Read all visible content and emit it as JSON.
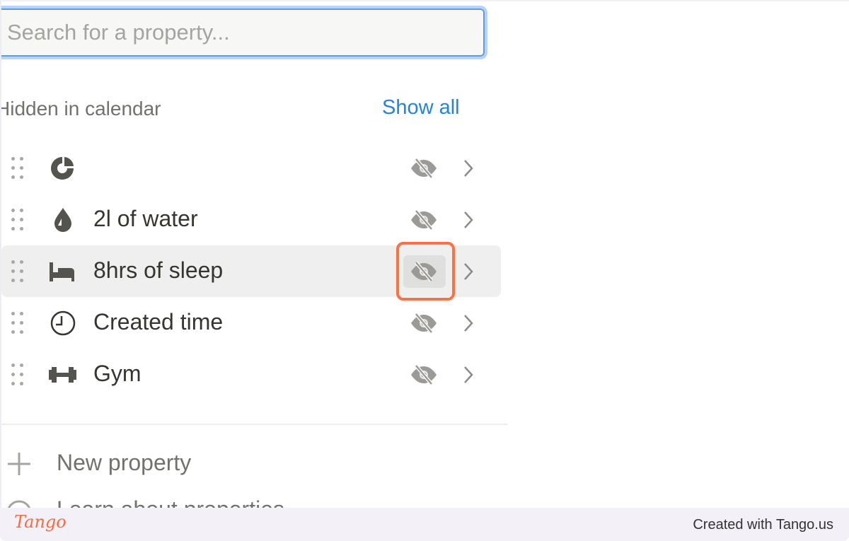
{
  "search": {
    "placeholder": "Search for a property...",
    "value": ""
  },
  "section": {
    "title": "Hidden in calendar",
    "show_all": "Show all"
  },
  "properties": [
    {
      "label": "",
      "icon": "pie-chart-icon",
      "visibility": "hidden"
    },
    {
      "label": "2l of water",
      "icon": "water-drop-icon",
      "visibility": "hidden"
    },
    {
      "label": "8hrs of sleep",
      "icon": "bed-icon",
      "visibility": "hidden",
      "highlighted": true
    },
    {
      "label": "Created time",
      "icon": "clock-icon",
      "visibility": "hidden"
    },
    {
      "label": "Gym",
      "icon": "dumbbell-icon",
      "visibility": "hidden"
    }
  ],
  "actions": {
    "new_property": "New property",
    "learn": "Learn about properties"
  },
  "footer": {
    "logo": "Tango",
    "credit": "Created with Tango.us"
  },
  "colors": {
    "accent": "#2383e2",
    "highlight": "#ff7043",
    "footer_bg": "#f3f1f7"
  }
}
